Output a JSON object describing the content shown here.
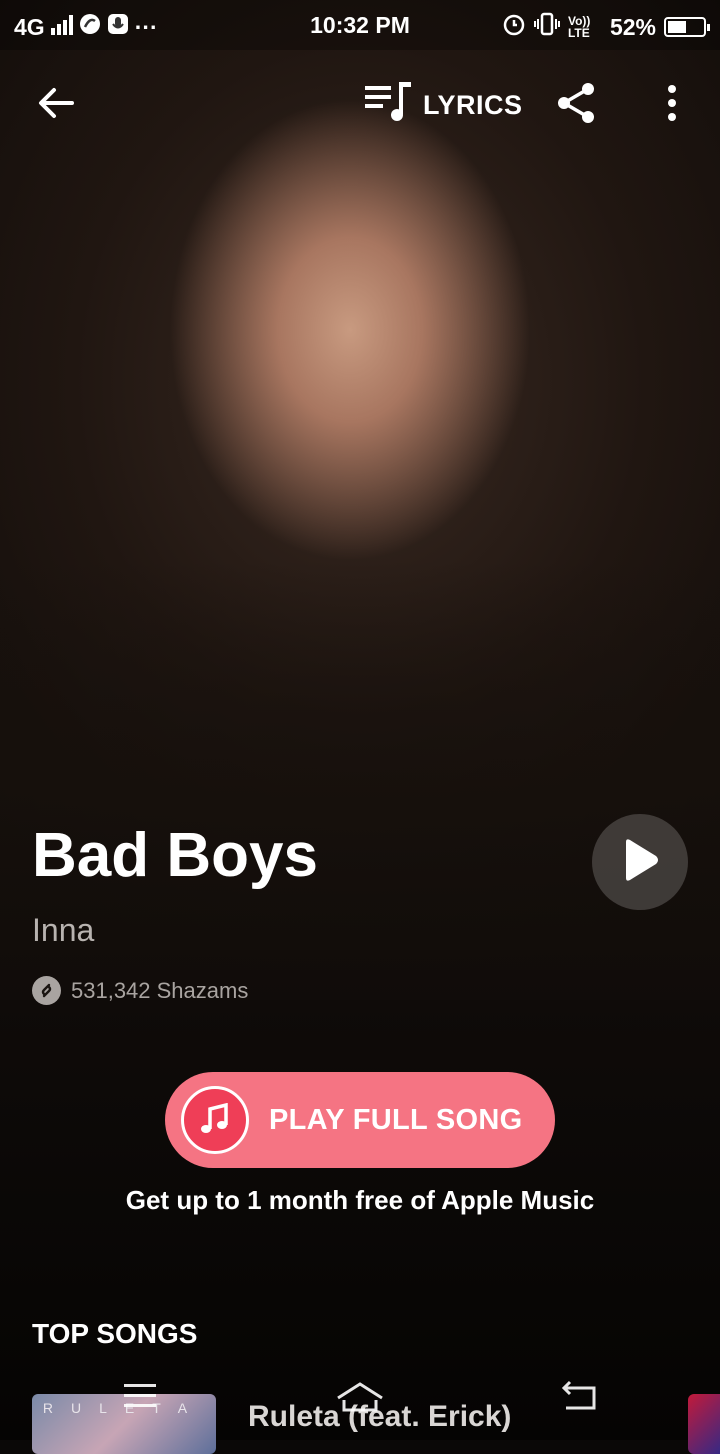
{
  "status_bar": {
    "network": "4G",
    "more": "···",
    "time": "10:32 PM",
    "volte": "Vo)) LTE",
    "battery": "52%",
    "battery_level": 0.52
  },
  "toolbar": {
    "lyrics_label": "LYRICS",
    "icons": [
      "back-arrow-icon",
      "lyrics-icon",
      "share-icon",
      "more-vert-icon"
    ]
  },
  "track": {
    "title": "Bad Boys",
    "artist": "Inna",
    "shazam_count": "531,342 Shazams"
  },
  "cta": {
    "play_full_song": "PLAY FULL SONG",
    "promo": "Get up to 1 month free of Apple Music"
  },
  "top_songs": {
    "heading": "TOP SONGS",
    "items": [
      {
        "title": "Ruleta (feat. Erick)",
        "thumb_text": "RULETA"
      }
    ]
  },
  "nav": {
    "icons": [
      "menu-icon",
      "home-icon",
      "back-icon"
    ]
  },
  "colors": {
    "accent": "#f57483",
    "apple_music_red": "#ef3e57"
  }
}
